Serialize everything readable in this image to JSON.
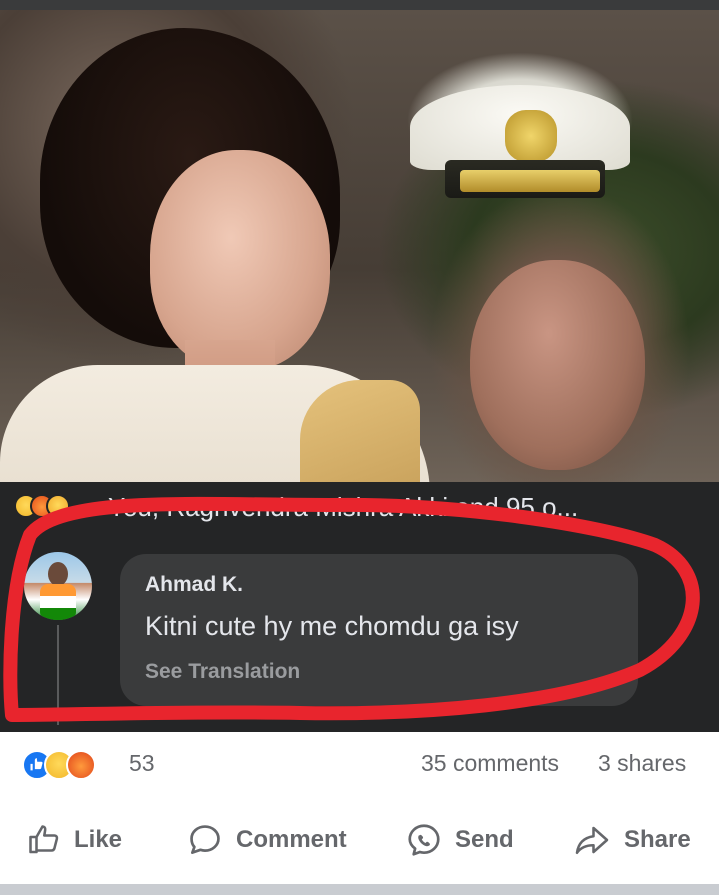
{
  "post_reactions_line": {
    "liked_by": "You, Raghvendra Mishra Akki and 95 o..."
  },
  "comment": {
    "author": "Ahmad K.",
    "text": "Kitni cute hy me chomdu ga isy",
    "see_translation": "See Translation"
  },
  "stats": {
    "reaction_count": "53",
    "comments": "35 comments",
    "shares": "3 shares"
  },
  "actions": {
    "like": "Like",
    "comment": "Comment",
    "send": "Send",
    "share": "Share"
  },
  "colors": {
    "dark_bg": "#242526",
    "bubble_bg": "#3a3b3c",
    "annotation_red": "#e8252d",
    "action_gray": "#65676b",
    "like_blue": "#1877f2"
  },
  "icons": [
    "like-icon",
    "sad-reaction-icon",
    "angry-reaction-icon",
    "care-reaction-icon",
    "thumbs-up-icon",
    "comment-bubble-icon",
    "messenger-icon",
    "share-arrow-icon"
  ]
}
